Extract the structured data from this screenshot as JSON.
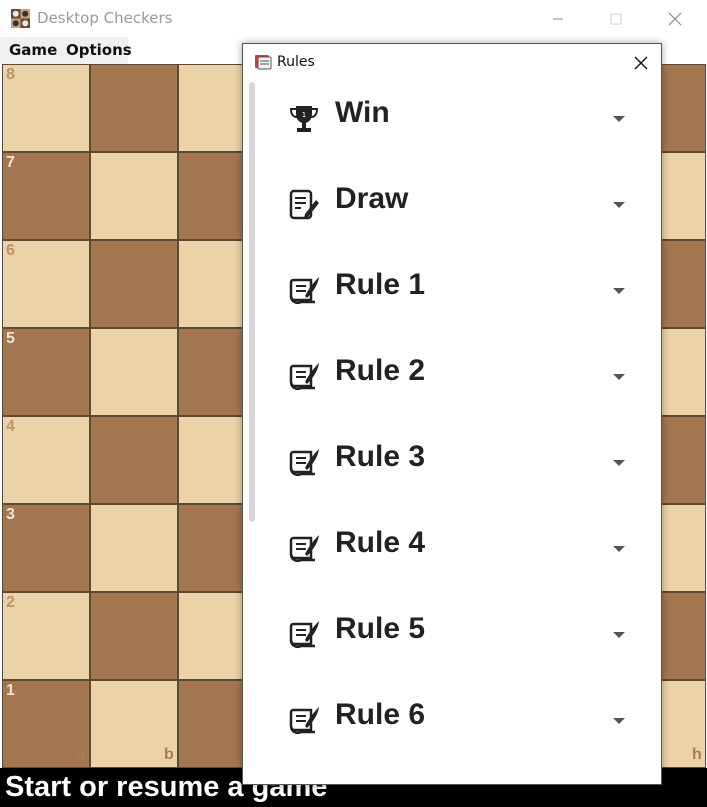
{
  "window": {
    "title": "Desktop Checkers",
    "app_icon": "checkers-board-icon",
    "minimize_icon": "minimize-icon",
    "maximize_icon": "maximize-icon",
    "close_icon": "close-icon"
  },
  "menu": {
    "game": "Game",
    "options": "Options"
  },
  "board": {
    "ranks": [
      "8",
      "7",
      "6",
      "5",
      "4",
      "3",
      "2",
      "1"
    ],
    "files_visible": [
      "a",
      "b",
      "h"
    ],
    "light_color": "#ecd3a7",
    "dark_color": "#a47650"
  },
  "status": {
    "text": "Start or resume a game"
  },
  "dialog": {
    "title": "Rules",
    "icon": "rules-book-icon",
    "close_icon": "close-icon",
    "items": [
      {
        "label": "Win",
        "icon": "trophy-icon"
      },
      {
        "label": "Draw",
        "icon": "document-edit-icon"
      },
      {
        "label": "Rule 1",
        "icon": "scroll-quill-icon"
      },
      {
        "label": "Rule 2",
        "icon": "scroll-quill-icon"
      },
      {
        "label": "Rule 3",
        "icon": "scroll-quill-icon"
      },
      {
        "label": "Rule 4",
        "icon": "scroll-quill-icon"
      },
      {
        "label": "Rule 5",
        "icon": "scroll-quill-icon"
      },
      {
        "label": "Rule 6",
        "icon": "scroll-quill-icon"
      }
    ]
  }
}
